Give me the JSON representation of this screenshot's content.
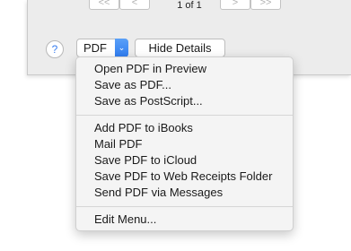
{
  "pager": {
    "first_label": "<<",
    "prev_label": "<",
    "page_indicator": "1 of 1",
    "next_label": ">",
    "last_label": ">>"
  },
  "buttons": {
    "help_label": "?",
    "pdf_label": "PDF",
    "pdf_arrow": "⌄",
    "hide_details_label": "Hide Details"
  },
  "pdf_menu": {
    "group1": [
      "Open PDF in Preview",
      "Save as PDF...",
      "Save as PostScript..."
    ],
    "group2": [
      "Add PDF to iBooks",
      "Mail PDF",
      "Save PDF to iCloud",
      "Save PDF to Web Receipts Folder",
      "Send PDF via Messages"
    ],
    "group3": [
      "Edit Menu..."
    ]
  },
  "colors": {
    "accent": "#2f7cf0",
    "dialog_bg": "#ececec",
    "menu_bg": "#f4f4f4"
  }
}
